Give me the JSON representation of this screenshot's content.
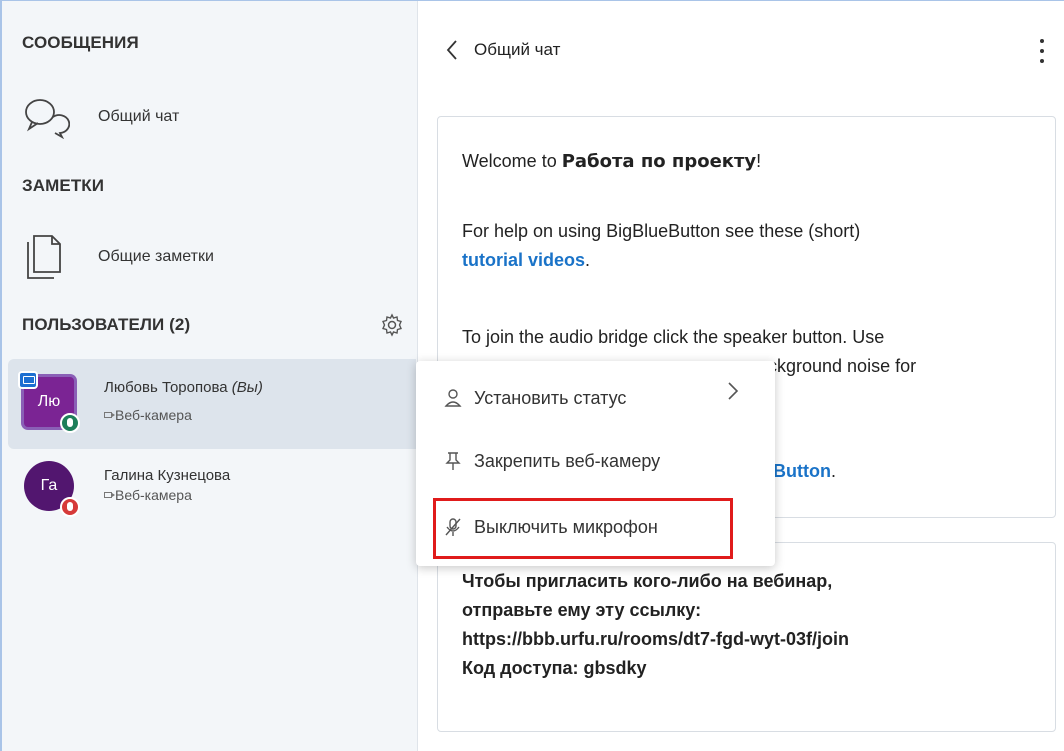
{
  "sidebar": {
    "messages_title": "СООБЩЕНИЯ",
    "chat_item_label": "Общий чат",
    "notes_title": "ЗАМЕТКИ",
    "notes_item_label": "Общие заметки",
    "users_title": "ПОЛЬЗОВАТЕЛИ (2)",
    "users": [
      {
        "initials": "Лю",
        "name": "Любовь Торопова",
        "you_tag": "(Вы)",
        "status": "Веб-камера",
        "mic": "on",
        "presenter": true
      },
      {
        "initials": "Га",
        "name": "Галина Кузнецова",
        "you_tag": "",
        "status": "Веб-камера",
        "mic": "muted",
        "presenter": false
      }
    ]
  },
  "chat": {
    "title": "Общий чат",
    "welcome_prefix": "Welcome to ",
    "welcome_room": "Работа по проекту",
    "welcome_suffix": "!",
    "help_text": "For help on using BigBlueButton see these (short)",
    "help_link": "tutorial videos",
    "help_end": ".",
    "audio_line1": "To join the audio bridge click the speaker button. Use",
    "audio_line2_tail": "ckground noise for",
    "button_tail": "Button",
    "button_end": ".",
    "invite_line1": "Чтобы пригласить кого-либо на вебинар,",
    "invite_line2": "отправьте ему эту ссылку:",
    "invite_url": "https://bbb.urfu.ru/rooms/dt7-fgd-wyt-03f/join",
    "access_label": "Код доступа: ",
    "access_code": "gbsdky"
  },
  "context_menu": {
    "items": [
      {
        "label": "Установить статус",
        "icon": "user-icon"
      },
      {
        "label": "Закрепить веб-камеру",
        "icon": "pin-icon"
      },
      {
        "label": "Выключить микрофон",
        "icon": "mic-off-icon"
      }
    ]
  },
  "colors": {
    "accent_link": "#1a73c8",
    "avatar_purple": "#7b2494",
    "highlight_red": "#e01b1b",
    "mic_on": "#1d7e5a",
    "mic_muted": "#d63a3a"
  }
}
